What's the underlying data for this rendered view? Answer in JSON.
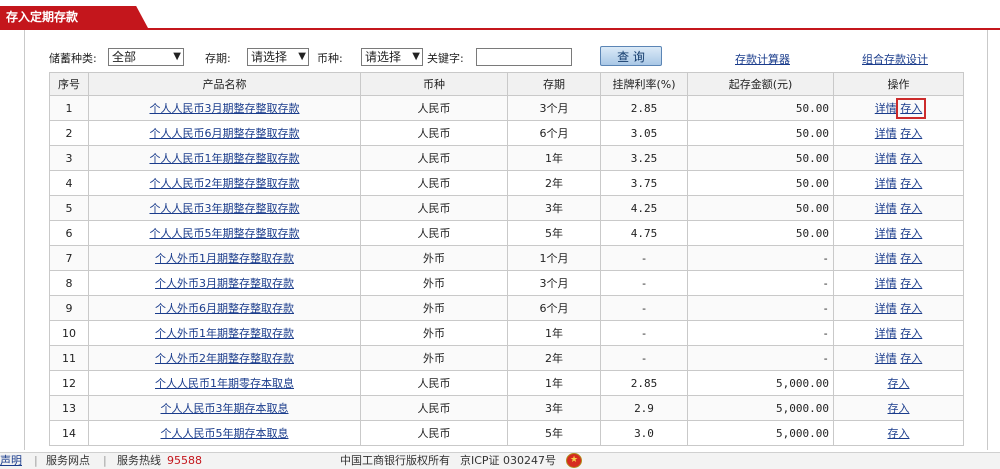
{
  "tab": {
    "title": "存入定期存款"
  },
  "filters": {
    "type_label": "储蓄种类:",
    "type_value": "全部",
    "term_label": "存期:",
    "term_value": "请选择",
    "currency_label": "币种:",
    "currency_value": "请选择",
    "keyword_label": "关键字:",
    "keyword_value": "",
    "search_button": "查 询",
    "calc_link": "存款计算器",
    "combo_link": "组合存款设计"
  },
  "table": {
    "headers": [
      "序号",
      "产品名称",
      "币种",
      "存期",
      "挂牌利率(%)",
      "起存金额(元)",
      "操作"
    ],
    "rows": [
      {
        "no": "1",
        "name": "个人人民币3月期整存整取存款",
        "currency": "人民币",
        "term": "3个月",
        "rate": "2.85",
        "min": "50.00",
        "detail": "详情",
        "deposit": "存入"
      },
      {
        "no": "2",
        "name": "个人人民币6月期整存整取存款",
        "currency": "人民币",
        "term": "6个月",
        "rate": "3.05",
        "min": "50.00",
        "detail": "详情",
        "deposit": "存入"
      },
      {
        "no": "3",
        "name": "个人人民币1年期整存整取存款",
        "currency": "人民币",
        "term": "1年",
        "rate": "3.25",
        "min": "50.00",
        "detail": "详情",
        "deposit": "存入"
      },
      {
        "no": "4",
        "name": "个人人民币2年期整存整取存款",
        "currency": "人民币",
        "term": "2年",
        "rate": "3.75",
        "min": "50.00",
        "detail": "详情",
        "deposit": "存入"
      },
      {
        "no": "5",
        "name": "个人人民币3年期整存整取存款",
        "currency": "人民币",
        "term": "3年",
        "rate": "4.25",
        "min": "50.00",
        "detail": "详情",
        "deposit": "存入"
      },
      {
        "no": "6",
        "name": "个人人民币5年期整存整取存款",
        "currency": "人民币",
        "term": "5年",
        "rate": "4.75",
        "min": "50.00",
        "detail": "详情",
        "deposit": "存入"
      },
      {
        "no": "7",
        "name": "个人外币1月期整存整取存款",
        "currency": "外币",
        "term": "1个月",
        "rate": "-",
        "min": "-",
        "detail": "详情",
        "deposit": "存入"
      },
      {
        "no": "8",
        "name": "个人外币3月期整存整取存款",
        "currency": "外币",
        "term": "3个月",
        "rate": "-",
        "min": "-",
        "detail": "详情",
        "deposit": "存入"
      },
      {
        "no": "9",
        "name": "个人外币6月期整存整取存款",
        "currency": "外币",
        "term": "6个月",
        "rate": "-",
        "min": "-",
        "detail": "详情",
        "deposit": "存入"
      },
      {
        "no": "10",
        "name": "个人外币1年期整存整取存款",
        "currency": "外币",
        "term": "1年",
        "rate": "-",
        "min": "-",
        "detail": "详情",
        "deposit": "存入"
      },
      {
        "no": "11",
        "name": "个人外币2年期整存整取存款",
        "currency": "外币",
        "term": "2年",
        "rate": "-",
        "min": "-",
        "detail": "详情",
        "deposit": "存入"
      },
      {
        "no": "12",
        "name": "个人人民币1年期零存本取息",
        "currency": "人民币",
        "term": "1年",
        "rate": "2.85",
        "min": "5,000.00",
        "detail": "",
        "deposit": "存入"
      },
      {
        "no": "13",
        "name": "个人人民币3年期存本取息",
        "currency": "人民币",
        "term": "3年",
        "rate": "2.9",
        "min": "5,000.00",
        "detail": "",
        "deposit": "存入"
      },
      {
        "no": "14",
        "name": "个人人民币5年期存本取息",
        "currency": "人民币",
        "term": "5年",
        "rate": "3.0",
        "min": "5,000.00",
        "detail": "",
        "deposit": "存入"
      }
    ]
  },
  "footer": {
    "statement": "声明",
    "outlets": "服务网点",
    "hotline_label": "服务热线",
    "hotline_number": "95588",
    "copyright": "中国工商银行版权所有",
    "icp": "京ICP证 030247号"
  },
  "colors": {
    "brand": "#c4161c",
    "link": "#1a3c8c"
  }
}
